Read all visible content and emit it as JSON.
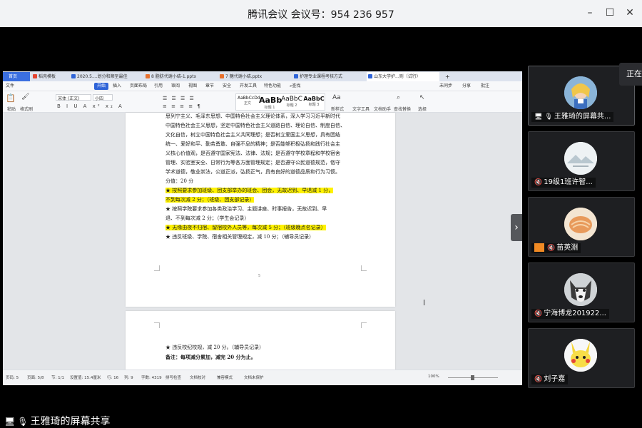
{
  "titlebar": {
    "title": "腾讯会议 会议号：954 236 957",
    "minimize": "–",
    "maximize": "☐",
    "close": "✕"
  },
  "wps": {
    "tabs": [
      {
        "label": "首页",
        "type": "home"
      },
      {
        "label": "稻壳模板",
        "color": "#e5432f"
      },
      {
        "label": "2020.5....划分和顺至最佳",
        "color": "#2f64d8"
      },
      {
        "label": "8 脂肪代谢小结-1.pptx",
        "color": "#e8712e"
      },
      {
        "label": "7 糖代谢小结.pptx",
        "color": "#e8712e"
      },
      {
        "label": "护理专业课程考核方式",
        "color": "#2f64d8"
      },
      {
        "label": "山东大学护...则（试行）",
        "color": "#2f64d8",
        "active": true
      }
    ],
    "tab_add": "+",
    "menu": [
      "文件",
      "开始",
      "插入",
      "页面布局",
      "引用",
      "审阅",
      "视图",
      "章节",
      "安全",
      "开发工具",
      "特色功能",
      "查找"
    ],
    "menu_right": [
      "未同步",
      "分享",
      "批注"
    ],
    "ribbon": {
      "paste": "粘贴",
      "format_painter": "格式刷",
      "font_name": "宋体 (正文)",
      "font_size": "小四",
      "styles": [
        {
          "sample": "AaBbCcDd",
          "label": "正文"
        },
        {
          "sample": "AaBb",
          "label": "标题 1"
        },
        {
          "sample": "AaBbC",
          "label": "标题 2"
        },
        {
          "sample": "AaBbC",
          "label": "标题 3"
        }
      ],
      "new_style": "新样式",
      "text_tools": "文字工具",
      "doc_helper": "文档助手",
      "find_replace": "查找替换",
      "select": "选择"
    },
    "page1_lines": [
      {
        "text": "思列宁主义、毛泽东思想、中国特色社会主义理论体系，深入学习习近平新时代"
      },
      {
        "text": "中国特色社会主义思想，坚定中国特色社会主义道路自信、理论自信、制度自信、"
      },
      {
        "text": "文化自信，树立中国特色社会主义共同理想；是否树立爱国主义思想，具有团结"
      },
      {
        "text": "统一、爱好和平、勤劳勇敢、自强不息的精神；是否能够积极弘扬和践行社会主"
      },
      {
        "text": "义核心价值观，是否遵守国家宪法、法律、法规；是否遵守学校章程和学校宿舍"
      },
      {
        "text": "管理、实验室安全、日常行为等各方面管理规定；是否遵守公民道德规范，恪守"
      },
      {
        "text": "学术道德，敬业崇法，公道正派，弘扬正气，具有良好的道德品质和行为习惯。"
      },
      {
        "text": "分值：20 分"
      },
      {
        "text": "★  按照要求参加班级、团支部举办的班会、团会，无故迟到、早退减 1 分，",
        "hl": true
      },
      {
        "text": "不到每次减 2 分；（班级、团支部记录）",
        "hl": true
      },
      {
        "text": "★  按照学院要求参加各类政治学习、主题讲座、时事报告，无故迟到、早"
      },
      {
        "text": "退、不到每次减 2 分；（学生会记录）"
      },
      {
        "text": "★  无缘由夜不归宿、留宿校外人员等，每次减 5 分；（班级晚点名记录）",
        "hl": true
      },
      {
        "text": "★  违反班级、学院、宿舍相关管理规定，减 10 分；（辅导员记录）"
      }
    ],
    "page1_number": "5",
    "page2_lines": [
      {
        "text": "★  违反校纪校规，减 20 分。（辅导员记录）"
      },
      {
        "text": "备注：每项减分累加，减完 20 分为止。",
        "bold": true
      }
    ],
    "status": {
      "items": [
        "页码: 5",
        "页面: 5/8",
        "节: 1/1",
        "设置值: 15.4厘米",
        "行: 16",
        "列: 9",
        "字数: 4319",
        "拼写检查",
        "文档校对",
        "兼容模式",
        "文档未保护"
      ],
      "zoom": "100%"
    }
  },
  "participants": [
    {
      "name": "王雅琦的屏幕共...",
      "sharing": true,
      "mic": "on",
      "avatar": "alice"
    },
    {
      "name": "19级1班许智...",
      "mic": "muted",
      "avatar": "landscape"
    },
    {
      "name": "苗英淵",
      "mic": "muted",
      "avatar": "food",
      "badge": true
    },
    {
      "name": "宁海博龙201922...",
      "mic": "muted",
      "avatar": "husky"
    },
    {
      "name": "刘子嘉",
      "mic": "muted",
      "avatar": "pikachu"
    }
  ],
  "tooltip": "正在",
  "bottom_label": "王雅琦的屏幕共享",
  "colors": {
    "accent": "#2f64d8",
    "highlight": "#fff200"
  }
}
